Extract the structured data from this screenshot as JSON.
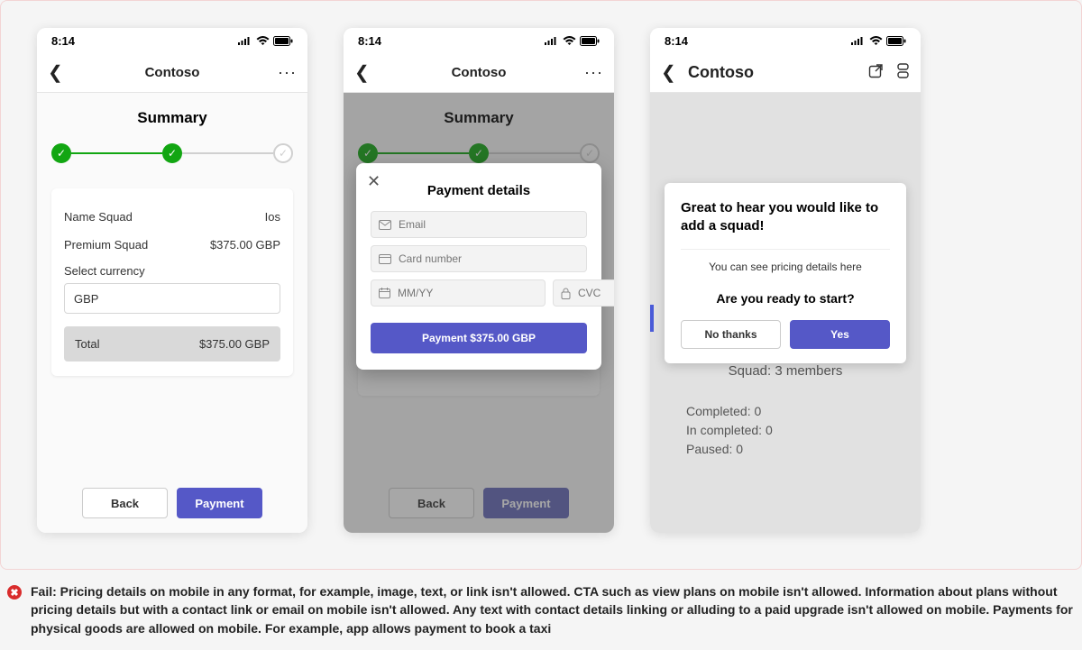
{
  "status": {
    "time": "8:14"
  },
  "header": {
    "app_title": "Contoso",
    "more": "···"
  },
  "screen1": {
    "title": "Summary",
    "row1_label": "Name Squad",
    "row1_value": "Ios",
    "row2_label": "Premium Squad",
    "row2_value": "$375.00 GBP",
    "currency_label": "Select currency",
    "currency_value": "GBP",
    "total_label": "Total",
    "total_value": "$375.00 GBP",
    "back_btn": "Back",
    "pay_btn": "Payment"
  },
  "screen2": {
    "title": "Summary",
    "modal_title": "Payment details",
    "email_placeholder": "Email",
    "card_placeholder": "Card number",
    "exp_placeholder": "MM/YY",
    "cvc_placeholder": "CVC",
    "pay_cta": "Payment $375.00 GBP",
    "back_btn": "Back",
    "pay_btn": "Payment"
  },
  "screen3": {
    "modal_title": "Great to hear you would like to add a squad!",
    "modal_sub": "You can see pricing details here",
    "modal_question": "Are you ready to start?",
    "no_btn": "No thanks",
    "yes_btn": "Yes",
    "bg_line1": "Squad: 3 members",
    "bg_line2": "Completed: 0",
    "bg_line3": "In completed: 0",
    "bg_line4": "Paused: 0"
  },
  "fail": {
    "text": "Fail: Pricing details on mobile in any format, for example, image, text, or link isn't allowed. CTA such as view plans on mobile isn't allowed. Information about plans without pricing details but with a contact link or email on mobile isn't allowed. Any text with contact details linking or alluding to a paid upgrade isn't allowed on mobile. Payments for physical goods are allowed on mobile. For example, app allows payment to book a taxi"
  }
}
